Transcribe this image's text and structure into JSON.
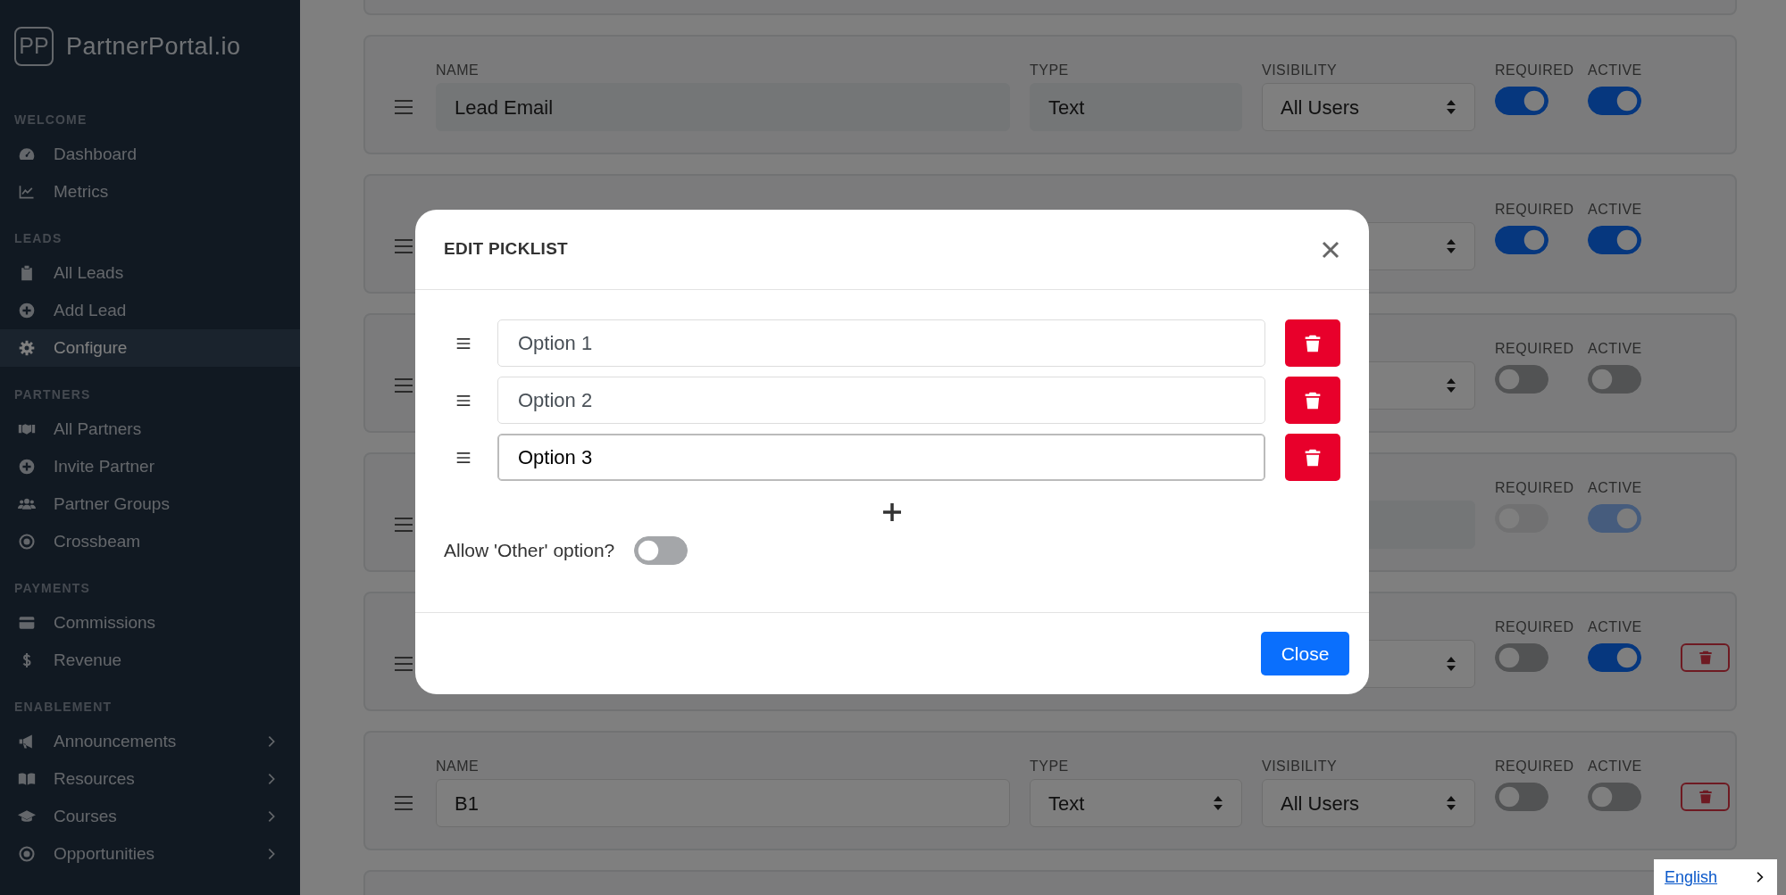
{
  "sidebar": {
    "logo": "PP",
    "brand": "PartnerPortal.io",
    "sections": [
      {
        "title": "WELCOME",
        "items": [
          {
            "label": "Dashboard",
            "selected": false,
            "has_submenu": false
          },
          {
            "label": "Metrics",
            "selected": false,
            "has_submenu": false
          }
        ]
      },
      {
        "title": "LEADS",
        "items": [
          {
            "label": "All Leads",
            "selected": false,
            "has_submenu": false
          },
          {
            "label": "Add Lead",
            "selected": false,
            "has_submenu": false
          },
          {
            "label": "Configure",
            "selected": true,
            "has_submenu": false
          }
        ]
      },
      {
        "title": "PARTNERS",
        "items": [
          {
            "label": "All Partners",
            "selected": false,
            "has_submenu": false
          },
          {
            "label": "Invite Partner",
            "selected": false,
            "has_submenu": false
          },
          {
            "label": "Partner Groups",
            "selected": false,
            "has_submenu": false
          },
          {
            "label": "Crossbeam",
            "selected": false,
            "has_submenu": false
          }
        ]
      },
      {
        "title": "PAYMENTS",
        "items": [
          {
            "label": "Commissions",
            "selected": false,
            "has_submenu": false
          },
          {
            "label": "Revenue",
            "selected": false,
            "has_submenu": false
          }
        ]
      },
      {
        "title": "ENABLEMENT",
        "items": [
          {
            "label": "Announcements",
            "selected": false,
            "has_submenu": true
          },
          {
            "label": "Resources",
            "selected": false,
            "has_submenu": true
          },
          {
            "label": "Courses",
            "selected": false,
            "has_submenu": true
          },
          {
            "label": "Opportunities",
            "selected": false,
            "has_submenu": true
          }
        ]
      }
    ]
  },
  "fields": [
    {
      "name": {
        "label": "NAME",
        "value": "Lead Email",
        "kind": "readonly"
      },
      "type": {
        "label": "TYPE",
        "value": "Text",
        "kind": "readonly"
      },
      "visibility": {
        "label": "VISIBILITY",
        "value": "All Users",
        "kind": "select"
      },
      "required": {
        "label": "REQUIRED",
        "on": true,
        "disabled": false
      },
      "active": {
        "label": "ACTIVE",
        "on": true,
        "disabled": false
      },
      "deletable": false
    },
    {
      "visibility": {
        "kind": "select"
      },
      "required": {
        "label": "REQUIRED",
        "on": true,
        "disabled": false
      },
      "active": {
        "label": "ACTIVE",
        "on": true,
        "disabled": false
      },
      "deletable": false
    },
    {
      "visibility": {
        "kind": "select"
      },
      "required": {
        "label": "REQUIRED",
        "on": false,
        "disabled": false
      },
      "active": {
        "label": "ACTIVE",
        "on": false,
        "disabled": false
      },
      "deletable": false
    },
    {
      "visibility": {
        "kind": "readonly"
      },
      "required": {
        "label": "REQUIRED",
        "on": false,
        "disabled": true
      },
      "active": {
        "label": "ACTIVE",
        "on": true,
        "disabled": true
      },
      "deletable": false
    },
    {
      "visibility": {
        "kind": "select"
      },
      "required": {
        "label": "REQUIRED",
        "on": false,
        "disabled": false
      },
      "active": {
        "label": "ACTIVE",
        "on": true,
        "disabled": false
      },
      "deletable": true
    },
    {
      "name": {
        "label": "NAME",
        "value": "B1",
        "kind": "input"
      },
      "type": {
        "label": "TYPE",
        "value": "Text",
        "kind": "select"
      },
      "visibility": {
        "label": "VISIBILITY",
        "value": "All Users",
        "kind": "select"
      },
      "required": {
        "label": "REQUIRED",
        "on": false,
        "disabled": false
      },
      "active": {
        "label": "ACTIVE",
        "on": false,
        "disabled": false
      },
      "deletable": true
    }
  ],
  "modal": {
    "title": "EDIT PICKLIST",
    "options": [
      {
        "value": "Option 1",
        "focused": false
      },
      {
        "value": "Option 2",
        "focused": false
      },
      {
        "value": "Option 3",
        "focused": true
      }
    ],
    "allow_other": {
      "label": "Allow 'Other' option?",
      "on": false
    },
    "close_label": "Close"
  },
  "language": {
    "label": "English"
  }
}
